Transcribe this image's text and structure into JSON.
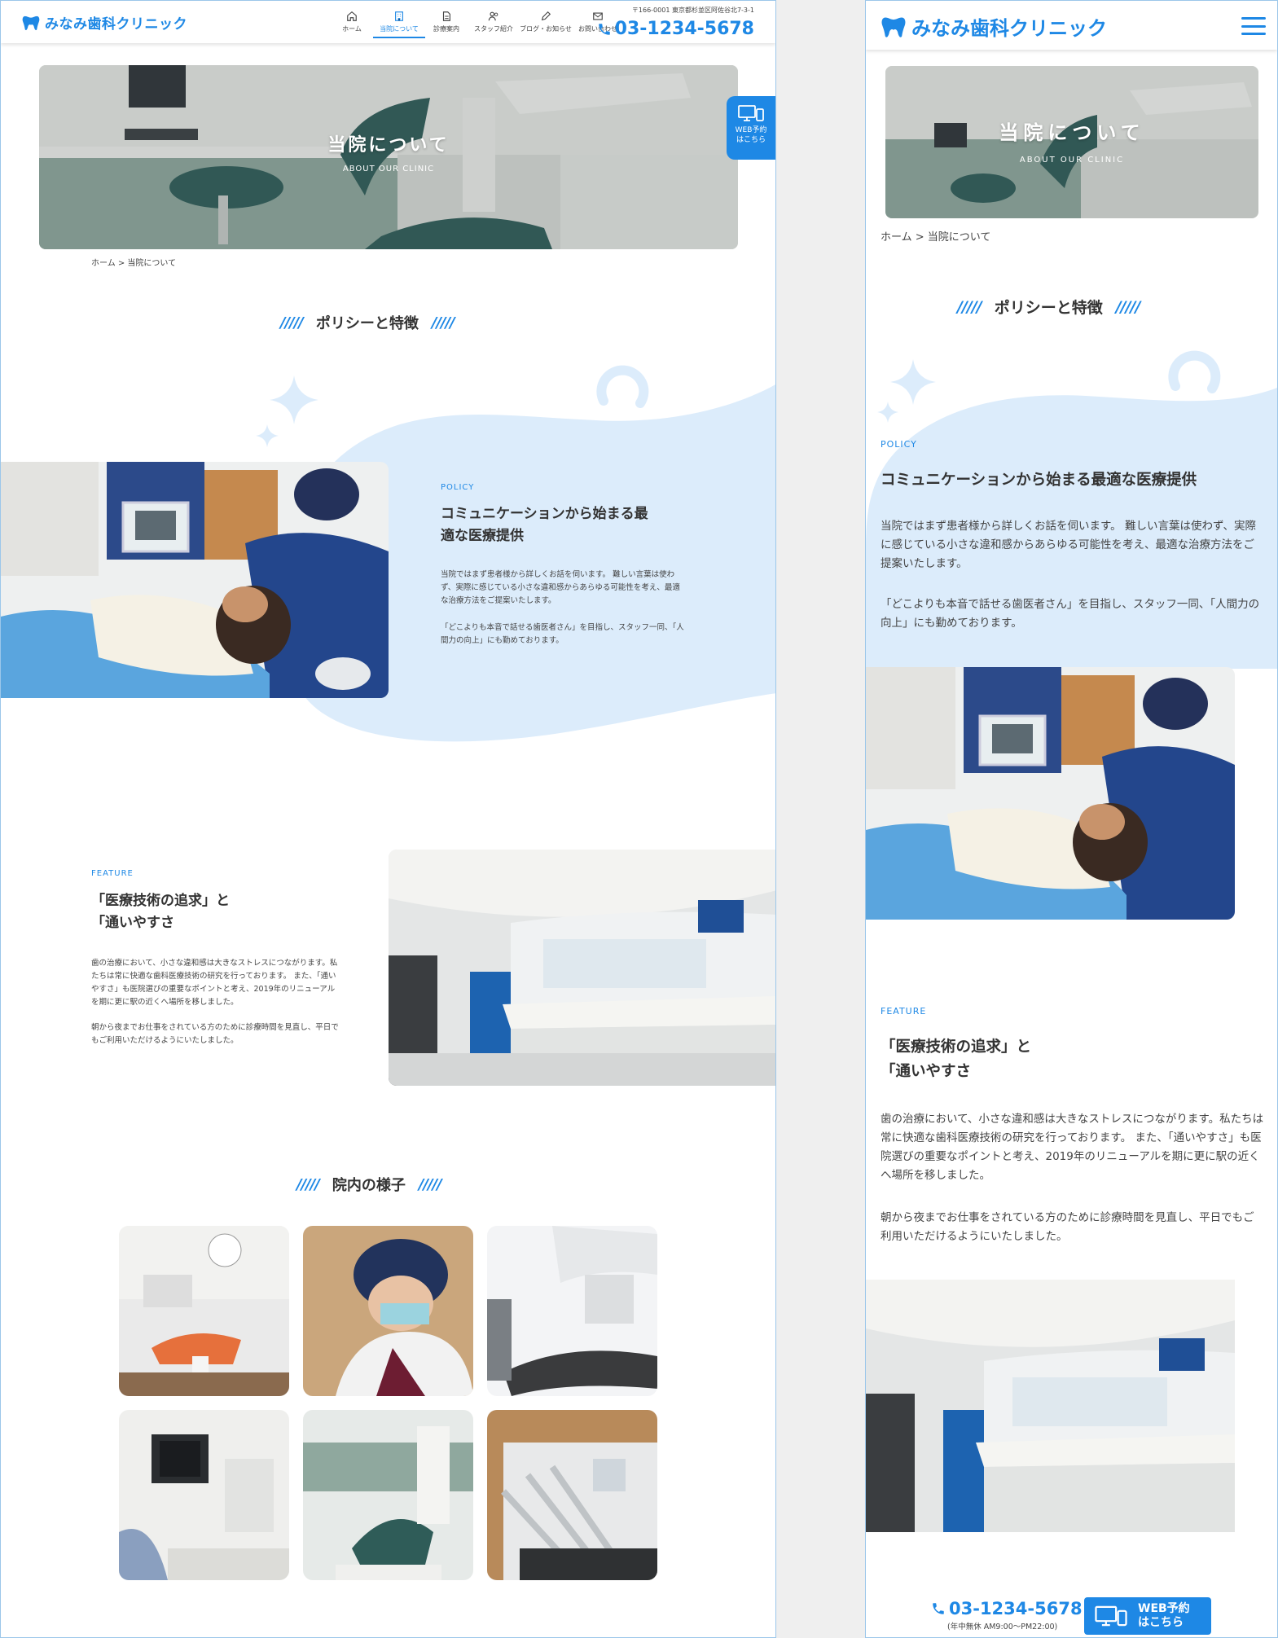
{
  "brand": {
    "name": "みなみ歯科クリニック",
    "color": "#1e88e5"
  },
  "desktop": {
    "header": {
      "address": "〒166-0001 東京都杉並区阿佐谷北7-3-1",
      "phone": "03-1234-5678",
      "nav": [
        {
          "label": "ホーム",
          "icon": "home-icon",
          "active": false
        },
        {
          "label": "当院について",
          "icon": "building-icon",
          "active": true
        },
        {
          "label": "診療案内",
          "icon": "document-icon",
          "active": false
        },
        {
          "label": "スタッフ紹介",
          "icon": "staff-icon",
          "active": false
        },
        {
          "label": "ブログ・お知らせ",
          "icon": "pen-icon",
          "active": false
        },
        {
          "label": "お問い合わせ",
          "icon": "mail-icon",
          "active": false
        }
      ]
    },
    "hero": {
      "title": "当院について",
      "subtitle": "ABOUT OUR CLINIC"
    },
    "web_button": {
      "line1": "WEB予約",
      "line2": "はこちら"
    },
    "breadcrumb": "ホーム > 当院について"
  },
  "policy_section": {
    "title": "ポリシーと特徴",
    "policy": {
      "label": "POLICY",
      "heading_line1": "コミュニケーションから始まる最",
      "heading_line2": "適な医療提供",
      "heading_full": "コミュニケーションから始まる最適な医療提供",
      "p1": "当院ではまず患者様から詳しくお話を伺います。 難しい言葉は使わず、実際に感じている小さな違和感からあらゆる可能性を考え、最適な治療方法をご提案いたします。",
      "p2": "「どこよりも本音で話せる歯医者さん」を目指し、スタッフ一同、「人間力の向上」にも勤めております。"
    },
    "feature": {
      "label": "FEATURE",
      "heading_line1": "「医療技術の追求」と",
      "heading_line2": "「通いやすさ",
      "p1": "歯の治療において、小さな違和感は大きなストレスにつながります。私たちは常に快適な歯科医療技術の研究を行っております。 また、「通いやすさ」も医院選びの重要なポイントと考え、2019年のリニューアルを期に更に駅の近くへ場所を移しました。",
      "p2": "朝から夜までお仕事をされている方のために診療時間を見直し、平日でもご利用いただけるようにいたしました。"
    }
  },
  "gallery": {
    "title": "院内の様子"
  },
  "mobile": {
    "hero_title": "当院について",
    "hero_subtitle": "ABOUT OUR CLINIC",
    "breadcrumb": "ホーム > 当院について",
    "footer_phone": "03-1234-5678",
    "footer_hours": "(年中無休 AM9:00〜PM22:00)",
    "footer_btn_line1": "WEB予約",
    "footer_btn_line2": "はこちら"
  }
}
